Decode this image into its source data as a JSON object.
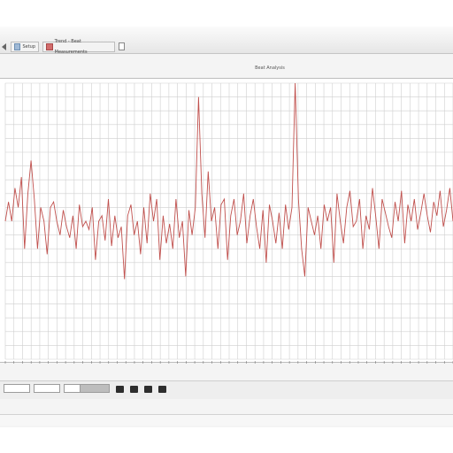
{
  "toolbar": {
    "tabs": [
      {
        "label": "Setup"
      },
      {
        "label": "Trend - Beat Measurements"
      }
    ]
  },
  "plot": {
    "title": "Beat Analysis"
  },
  "status": {
    "fields": [
      "",
      "",
      "",
      ""
    ],
    "controls": [
      "play-icon",
      "pause-icon",
      "stop-icon",
      "record-icon"
    ]
  },
  "colors": {
    "trace": "#c0504d",
    "grid": "#cfcfcf",
    "minorgrid": "#e6e6e6"
  },
  "chart_data": {
    "type": "line",
    "ylim": [
      0,
      100
    ],
    "values": [
      50,
      57,
      50,
      62,
      55,
      66,
      40,
      60,
      72,
      58,
      40,
      55,
      50,
      38,
      55,
      57,
      50,
      45,
      54,
      48,
      44,
      52,
      40,
      56,
      48,
      50,
      47,
      55,
      36,
      50,
      52,
      43,
      58,
      41,
      52,
      44,
      48,
      29,
      52,
      56,
      45,
      50,
      38,
      55,
      42,
      60,
      50,
      58,
      36,
      52,
      42,
      49,
      40,
      58,
      44,
      50,
      30,
      54,
      45,
      55,
      95,
      60,
      44,
      68,
      50,
      55,
      40,
      56,
      58,
      36,
      52,
      58,
      45,
      50,
      60,
      42,
      52,
      58,
      48,
      40,
      54,
      35,
      56,
      50,
      42,
      53,
      40,
      56,
      47,
      55,
      100,
      58,
      40,
      30,
      55,
      50,
      45,
      52,
      40,
      56,
      50,
      55,
      35,
      60,
      50,
      42,
      55,
      61,
      48,
      50,
      58,
      40,
      52,
      47,
      62,
      52,
      40,
      58,
      53,
      48,
      44,
      57,
      50,
      61,
      42,
      56,
      50,
      58,
      47,
      53,
      60,
      52,
      46,
      57,
      52,
      61,
      48,
      54,
      62,
      50
    ]
  }
}
